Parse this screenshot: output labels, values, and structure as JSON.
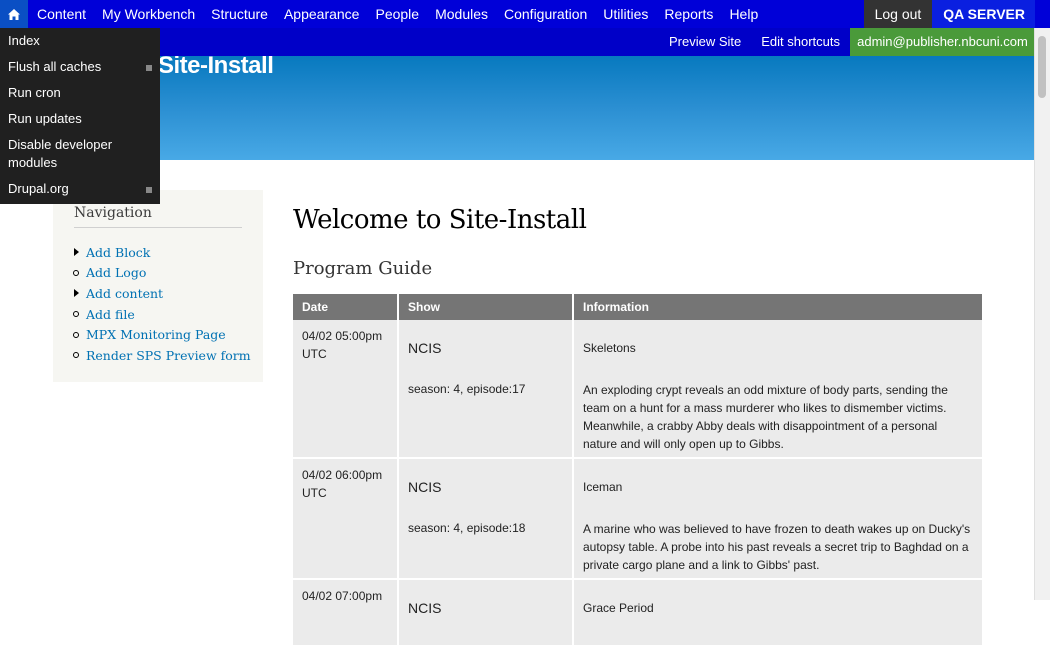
{
  "toolbar": {
    "menu": [
      "Content",
      "My Workbench",
      "Structure",
      "Appearance",
      "People",
      "Modules",
      "Configuration",
      "Utilities",
      "Reports",
      "Help"
    ],
    "logout": "Log out",
    "server": "QA SERVER"
  },
  "shortcuts": {
    "preview": "Preview Site",
    "edit": "Edit shortcuts",
    "user": "admin@publisher.nbcuni.com"
  },
  "dropdown": {
    "items": [
      "Index",
      "Flush all caches",
      "Run cron",
      "Run updates",
      "Disable developer modules",
      "Drupal.org"
    ]
  },
  "header": {
    "site_name": "Site-Install"
  },
  "sidebar": {
    "title": "Navigation",
    "items": [
      "Add Block",
      "Add Logo",
      "Add content",
      "Add file",
      "MPX Monitoring Page",
      "Render SPS Preview form"
    ]
  },
  "main": {
    "title": "Welcome to Site-Install",
    "subtitle": "Program Guide"
  },
  "guide": {
    "headers": [
      "Date",
      "Show",
      "Information"
    ],
    "rows": [
      {
        "date": "04/02 05:00pm UTC",
        "show": "NCIS",
        "episode": "season: 4, episode:17",
        "title": "Skeletons",
        "description": "An exploding crypt reveals an odd mixture of body parts, sending the team on a hunt for a mass murderer who likes to dismember victims. Meanwhile, a crabby Abby deals with disappointment of a personal nature and will only open up to Gibbs."
      },
      {
        "date": "04/02 06:00pm UTC",
        "show": "NCIS",
        "episode": "season: 4, episode:18",
        "title": "Iceman",
        "description": "A marine who was believed to have frozen to death wakes up on Ducky's autopsy table. A probe into his past reveals a secret trip to Baghdad on a private cargo plane and a link to Gibbs' past."
      },
      {
        "date": "04/02 07:00pm",
        "show": "NCIS",
        "episode": "",
        "title": "Grace Period",
        "description": ""
      }
    ]
  }
}
